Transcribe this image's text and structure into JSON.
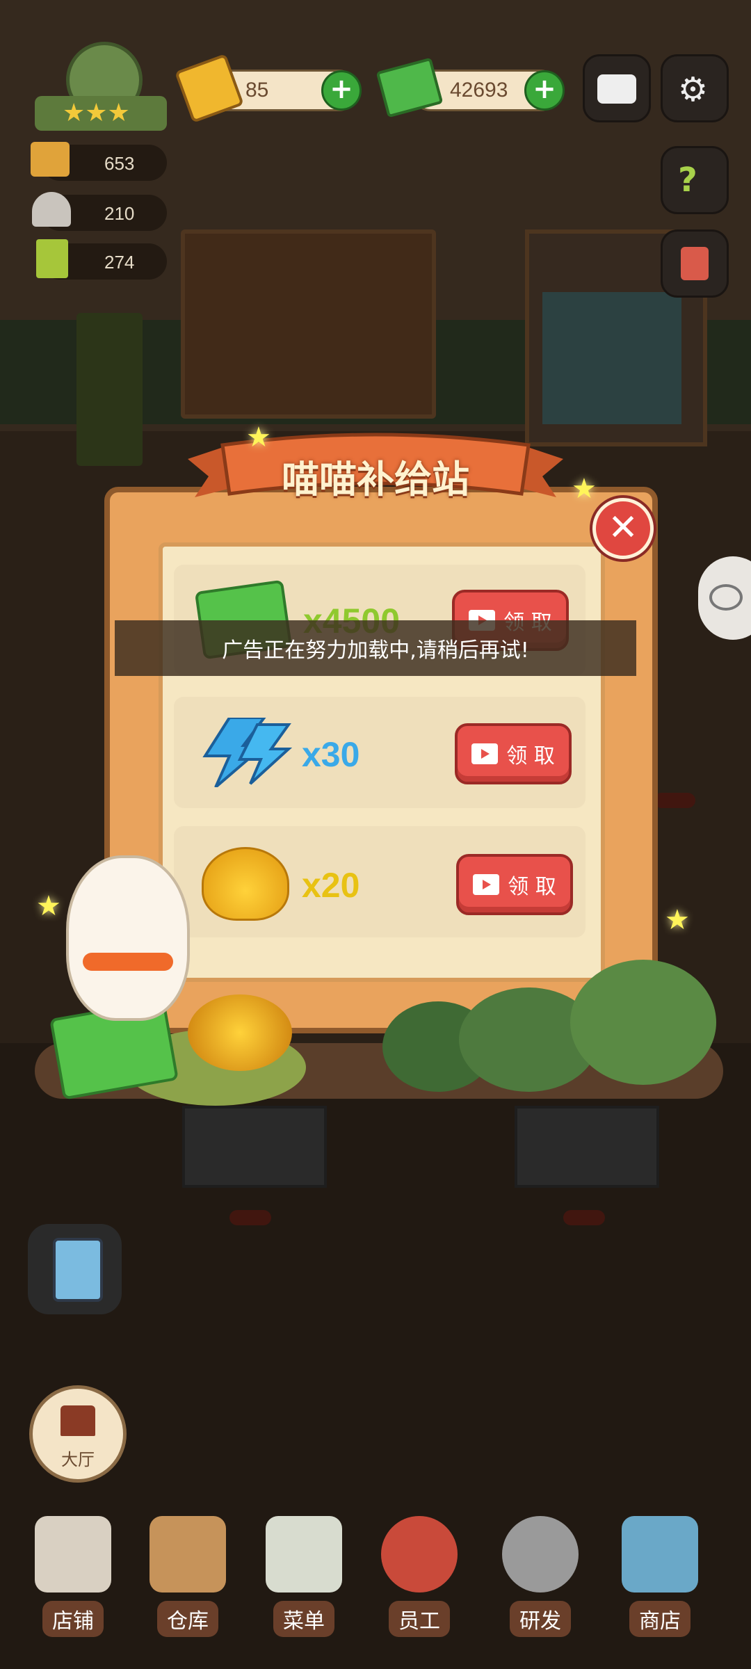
{
  "hud": {
    "gem_count": "85",
    "cash_count": "42693",
    "stats": [
      {
        "icon": "dishes-icon",
        "value": "653"
      },
      {
        "icon": "service-bell-icon",
        "value": "210"
      },
      {
        "icon": "bill-icon",
        "value": "274"
      }
    ]
  },
  "popup": {
    "title": "喵喵补给站",
    "rows": [
      {
        "icon": "cash-stack-icon",
        "amount": "x4500",
        "claim_label": "领 取"
      },
      {
        "icon": "lightning-icon",
        "amount": "x30",
        "claim_label": "领 取"
      },
      {
        "icon": "gold-pile-icon",
        "amount": "x20",
        "claim_label": "领 取"
      }
    ],
    "toast": "广告正在努力加载中,请稍后再试!"
  },
  "side": {
    "hall_label": "大厅"
  },
  "nav": [
    {
      "icon": "shop-building-icon",
      "label": "店铺"
    },
    {
      "icon": "warehouse-box-icon",
      "label": "仓库"
    },
    {
      "icon": "menu-clipboard-icon",
      "label": "菜单"
    },
    {
      "icon": "staff-chef-icon",
      "label": "员工"
    },
    {
      "icon": "wok-research-icon",
      "label": "研发"
    },
    {
      "icon": "store-front-icon",
      "label": "商店"
    }
  ],
  "colors": {
    "accent_red": "#e8514b",
    "accent_green": "#3aa83a",
    "panel": "#f6e7c2"
  }
}
